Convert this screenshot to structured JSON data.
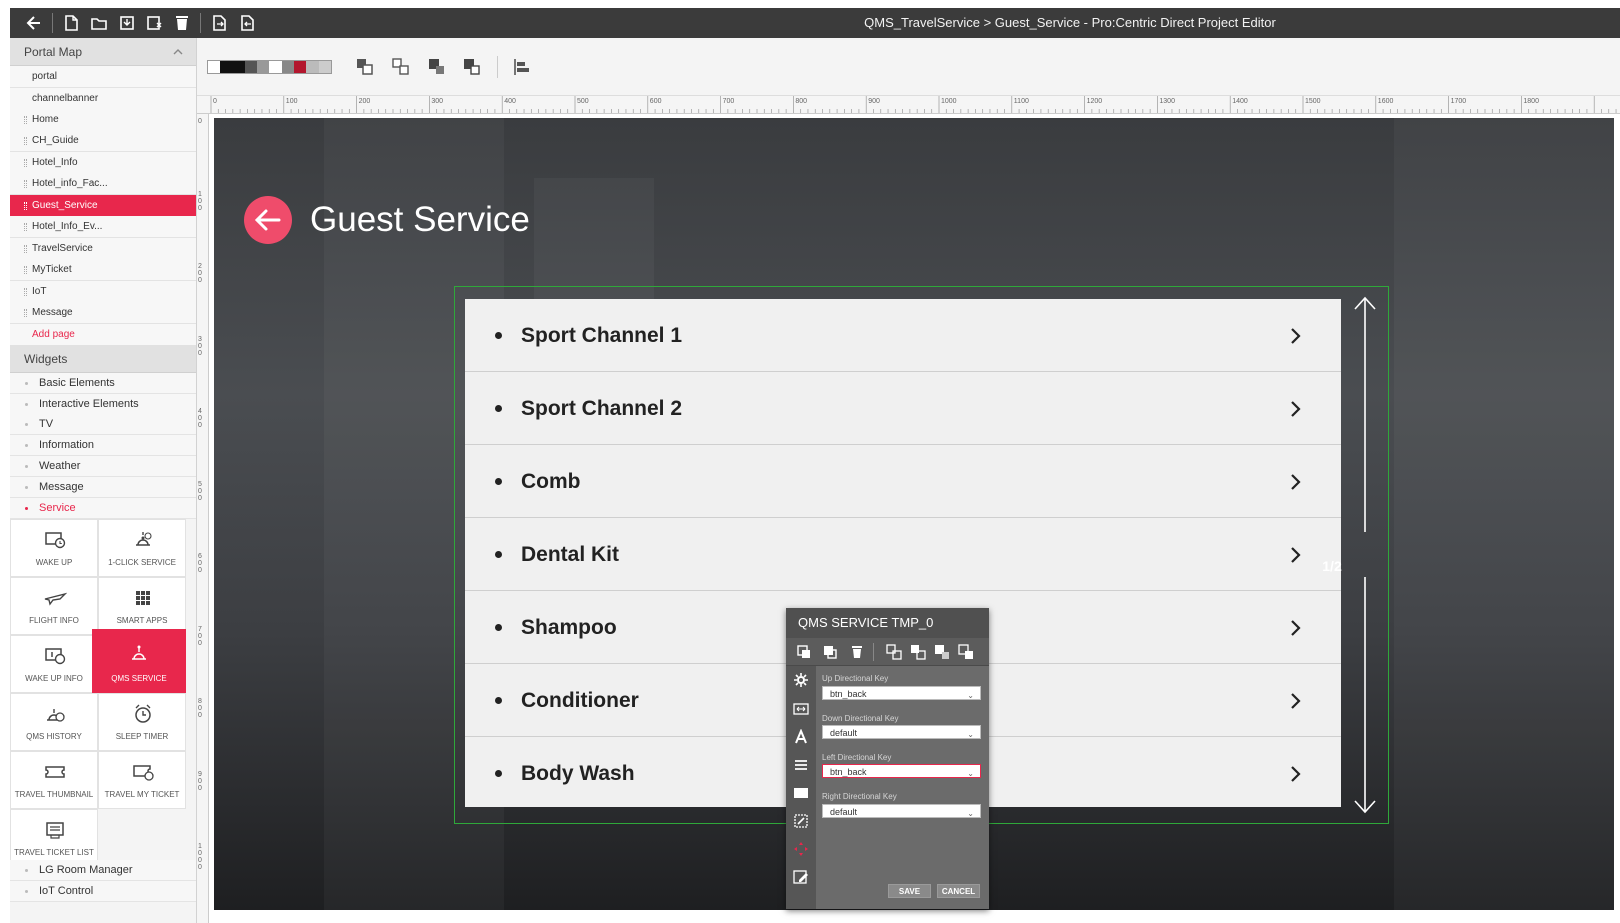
{
  "window": {
    "title": "QMS_TravelService > Guest_Service - Pro:Centric Direct Project Editor"
  },
  "portal_map": {
    "header": "Portal Map",
    "items": [
      {
        "label": "portal",
        "active": false
      },
      {
        "label": "channelbanner",
        "active": false
      },
      {
        "label": "Home",
        "active": false
      },
      {
        "label": "CH_Guide",
        "active": false
      },
      {
        "label": "Hotel_Info",
        "active": false
      },
      {
        "label": "Hotel_info_Fac...",
        "active": false
      },
      {
        "label": "Guest_Service",
        "active": true
      },
      {
        "label": "Hotel_Info_Ev...",
        "active": false
      },
      {
        "label": "TravelService",
        "active": false
      },
      {
        "label": "MyTicket",
        "active": false
      },
      {
        "label": "IoT",
        "active": false
      },
      {
        "label": "Message",
        "active": false
      }
    ],
    "add_page": "Add page"
  },
  "widgets": {
    "header": "Widgets",
    "categories": [
      {
        "label": "Basic Elements"
      },
      {
        "label": "Interactive Elements"
      },
      {
        "label": "TV"
      },
      {
        "label": "Information"
      },
      {
        "label": "Weather"
      },
      {
        "label": "Message"
      },
      {
        "label": "Service"
      }
    ],
    "service_tiles": [
      {
        "label": "WAKE UP",
        "icon": "wake-up-icon"
      },
      {
        "label": "1-CLICK SERVICE",
        "icon": "bell-icon"
      },
      {
        "label": "FLIGHT INFO",
        "icon": "airplane-icon"
      },
      {
        "label": "SMART APPS",
        "icon": "apps-grid-icon"
      },
      {
        "label": "WAKE UP INFO",
        "icon": "wake-up-info-icon"
      },
      {
        "label": "QMS SERVICE",
        "icon": "service-bell-icon"
      },
      {
        "label": "QMS HISTORY",
        "icon": "qms-history-icon"
      },
      {
        "label": "SLEEP TIMER",
        "icon": "sleep-timer-icon"
      },
      {
        "label": "TRAVEL THUMBNAIL",
        "icon": "ticket-icon"
      },
      {
        "label": "TRAVEL MY TICKET",
        "icon": "ticket-clock-icon"
      },
      {
        "label": "TRAVEL TICKET LIST",
        "icon": "ticket-list-icon"
      }
    ],
    "more_categories": [
      {
        "label": "LG Room Manager"
      },
      {
        "label": "IoT Control"
      }
    ]
  },
  "ruler": {
    "top_labels": [
      "0",
      "100",
      "200",
      "300",
      "400",
      "500",
      "600",
      "700",
      "800",
      "900",
      "1000",
      "1100",
      "1200",
      "1300",
      "1400",
      "1500",
      "1600",
      "1700",
      "1800"
    ],
    "left_labels": [
      "0",
      "100",
      "200",
      "300",
      "400",
      "500",
      "600",
      "700",
      "800",
      "900",
      "1000"
    ]
  },
  "canvas": {
    "heading": "Guest Service",
    "list_items": [
      "Sport Channel 1",
      "Sport Channel 2",
      "Comb",
      "Dental Kit",
      "Shampoo",
      "Conditioner",
      "Body Wash"
    ],
    "page_indicator": "1/2"
  },
  "properties": {
    "title": "QMS SERVICE TMP_0",
    "fields": [
      {
        "label": "Up Directional Key",
        "value": "btn_back",
        "alert": false
      },
      {
        "label": "Down Directional Key",
        "value": "default",
        "alert": false
      },
      {
        "label": "Left Directional Key",
        "value": "btn_back",
        "alert": true
      },
      {
        "label": "Right Directional Key",
        "value": "default",
        "alert": false
      }
    ],
    "save_label": "SAVE",
    "cancel_label": "CANCEL"
  },
  "colors": {
    "accent": "#e8274c",
    "titlebar": "#3b3b3b",
    "selection_border": "#2fa83a"
  }
}
